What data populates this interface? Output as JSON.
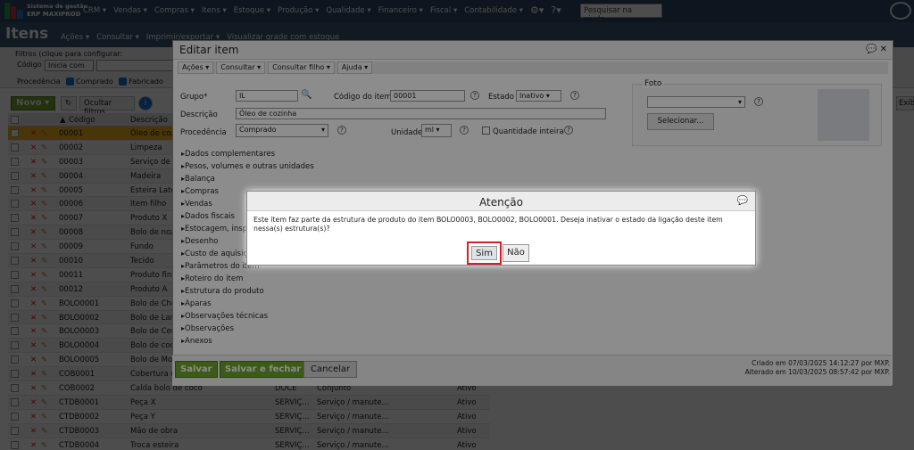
{
  "header": {
    "brand_line1": "Sistema de gestão",
    "brand_line2": "ERP MAXIPROD",
    "menu": [
      "CRM ▾",
      "Vendas ▾",
      "Compras ▾",
      "Itens ▾",
      "Estoque ▾",
      "Produção ▾",
      "Qualidade ▾",
      "Financeiro ▾",
      "Fiscal ▾",
      "Contabilidade ▾"
    ],
    "search_placeholder": "Pesquisar na ajuda..."
  },
  "page": {
    "title": "Itens",
    "subtitle": [
      "Ações ▾",
      "Consultar ▾",
      "Imprimir/exportar ▾",
      "Visualizar grade com estoque"
    ]
  },
  "filters": {
    "hint": "Filtros (clique para configurar:",
    "codigo_label": "Código",
    "codigo_value": "Inicia com",
    "procedencia_label": "Procedência",
    "comprado": "Comprado",
    "fabricado": "Fabricado"
  },
  "toolbar": {
    "novo": "Novo",
    "ocultar": "Ocultar filtros",
    "exib": "Exib"
  },
  "grid": {
    "col_codigo": "Código",
    "col_descricao": "Descrição",
    "rows": [
      {
        "code": "00001",
        "desc": "Óleo de coz"
      },
      {
        "code": "00002",
        "desc": "Limpeza"
      },
      {
        "code": "00003",
        "desc": "Serviço de l"
      },
      {
        "code": "00004",
        "desc": "Madeira"
      },
      {
        "code": "00005",
        "desc": "Esteira Late"
      },
      {
        "code": "00006",
        "desc": "Item filho"
      },
      {
        "code": "00007",
        "desc": "Produto X"
      },
      {
        "code": "00008",
        "desc": "Bolo de noz"
      },
      {
        "code": "00009",
        "desc": "Fundo"
      },
      {
        "code": "00010",
        "desc": "Tecido"
      },
      {
        "code": "00011",
        "desc": "Produto fina"
      },
      {
        "code": "00012",
        "desc": "Produto A"
      },
      {
        "code": "BOLO0001",
        "desc": "Bolo de Cho"
      },
      {
        "code": "BOLO0002",
        "desc": "Bolo de Lara"
      },
      {
        "code": "BOLO0003",
        "desc": "Bolo de Cen"
      },
      {
        "code": "BOLO0004",
        "desc": "Bolo de coco"
      },
      {
        "code": "BOLO0005",
        "desc": "Bolo de Mor"
      },
      {
        "code": "COB0001",
        "desc": "Cobertura d"
      },
      {
        "code": "COB0002",
        "desc": "Calda bolo de coco",
        "c3": "DOCE",
        "c4": "Conjunto",
        "c5": "Ativo"
      },
      {
        "code": "CTDB0001",
        "desc": "Peça X",
        "c3": "SERVIÇ...",
        "c4": "Serviço / manute...",
        "c5": "Ativo"
      },
      {
        "code": "CTDB0002",
        "desc": "Peça Y",
        "c3": "SERVIÇ...",
        "c4": "Serviço / manute...",
        "c5": "Ativo"
      },
      {
        "code": "CTDB0003",
        "desc": "Mão de obra",
        "c3": "SERVIÇ...",
        "c4": "Serviço / manute...",
        "c5": "Ativo"
      },
      {
        "code": "CTDB0004",
        "desc": "Troca esteira",
        "c3": "SERVIÇ...",
        "c4": "Serviço / manute...",
        "c5": "Ativo"
      }
    ]
  },
  "edit": {
    "title": "Editar item",
    "menu": [
      "Ações ▾",
      "Consultar ▾",
      "Consultar filho ▾",
      "Ajuda ▾"
    ],
    "grupo_label": "Grupo*",
    "grupo_value": "IL",
    "codigo_label": "Código do item",
    "codigo_value": "00001",
    "estado_label": "Estado",
    "estado_value": "Inativo",
    "descricao_label": "Descrição",
    "descricao_value": "Óleo de cozinha",
    "procedencia_label": "Procedência",
    "procedencia_value": "Comprado",
    "unidade_label": "Unidade",
    "unidade_value": "ml",
    "qtd_inteira": "Quantidade inteira",
    "foto_label": "Foto",
    "selecionar": "Selecionar...",
    "sections": [
      "Dados complementares",
      "Pesos, volumes e outras unidades",
      "Balança",
      "Compras",
      "Vendas",
      "Dados fiscais",
      "Estocagem, insp",
      "Desenho",
      "Custo de aquisiç",
      "Parâmetros do item",
      "Roteiro do item",
      "Estrutura do produto",
      "Aparas",
      "Observações técnicas",
      "Observações",
      "Anexos"
    ],
    "salvar": "Salvar",
    "salvar_fechar": "Salvar e fechar",
    "cancelar": "Cancelar",
    "criado": "Criado em 07/03/2025 14:12:27 por MXP.",
    "alterado": "Alterado em 10/03/2025 08:57:42 por MXP."
  },
  "dialog": {
    "title": "Atenção",
    "message": "Este item faz parte da estrutura de produto do item BOLO0003, BOLO0002, BOLO0001. Deseja inativar o estado da ligação deste item nessa(s) estrutura(s)?",
    "sim": "Sim",
    "nao": "Não"
  },
  "colors": {
    "header": "#2c4a66",
    "accent_green": "#6ea62c",
    "highlight": "#f2b51c",
    "alert_red": "#d61f26"
  }
}
